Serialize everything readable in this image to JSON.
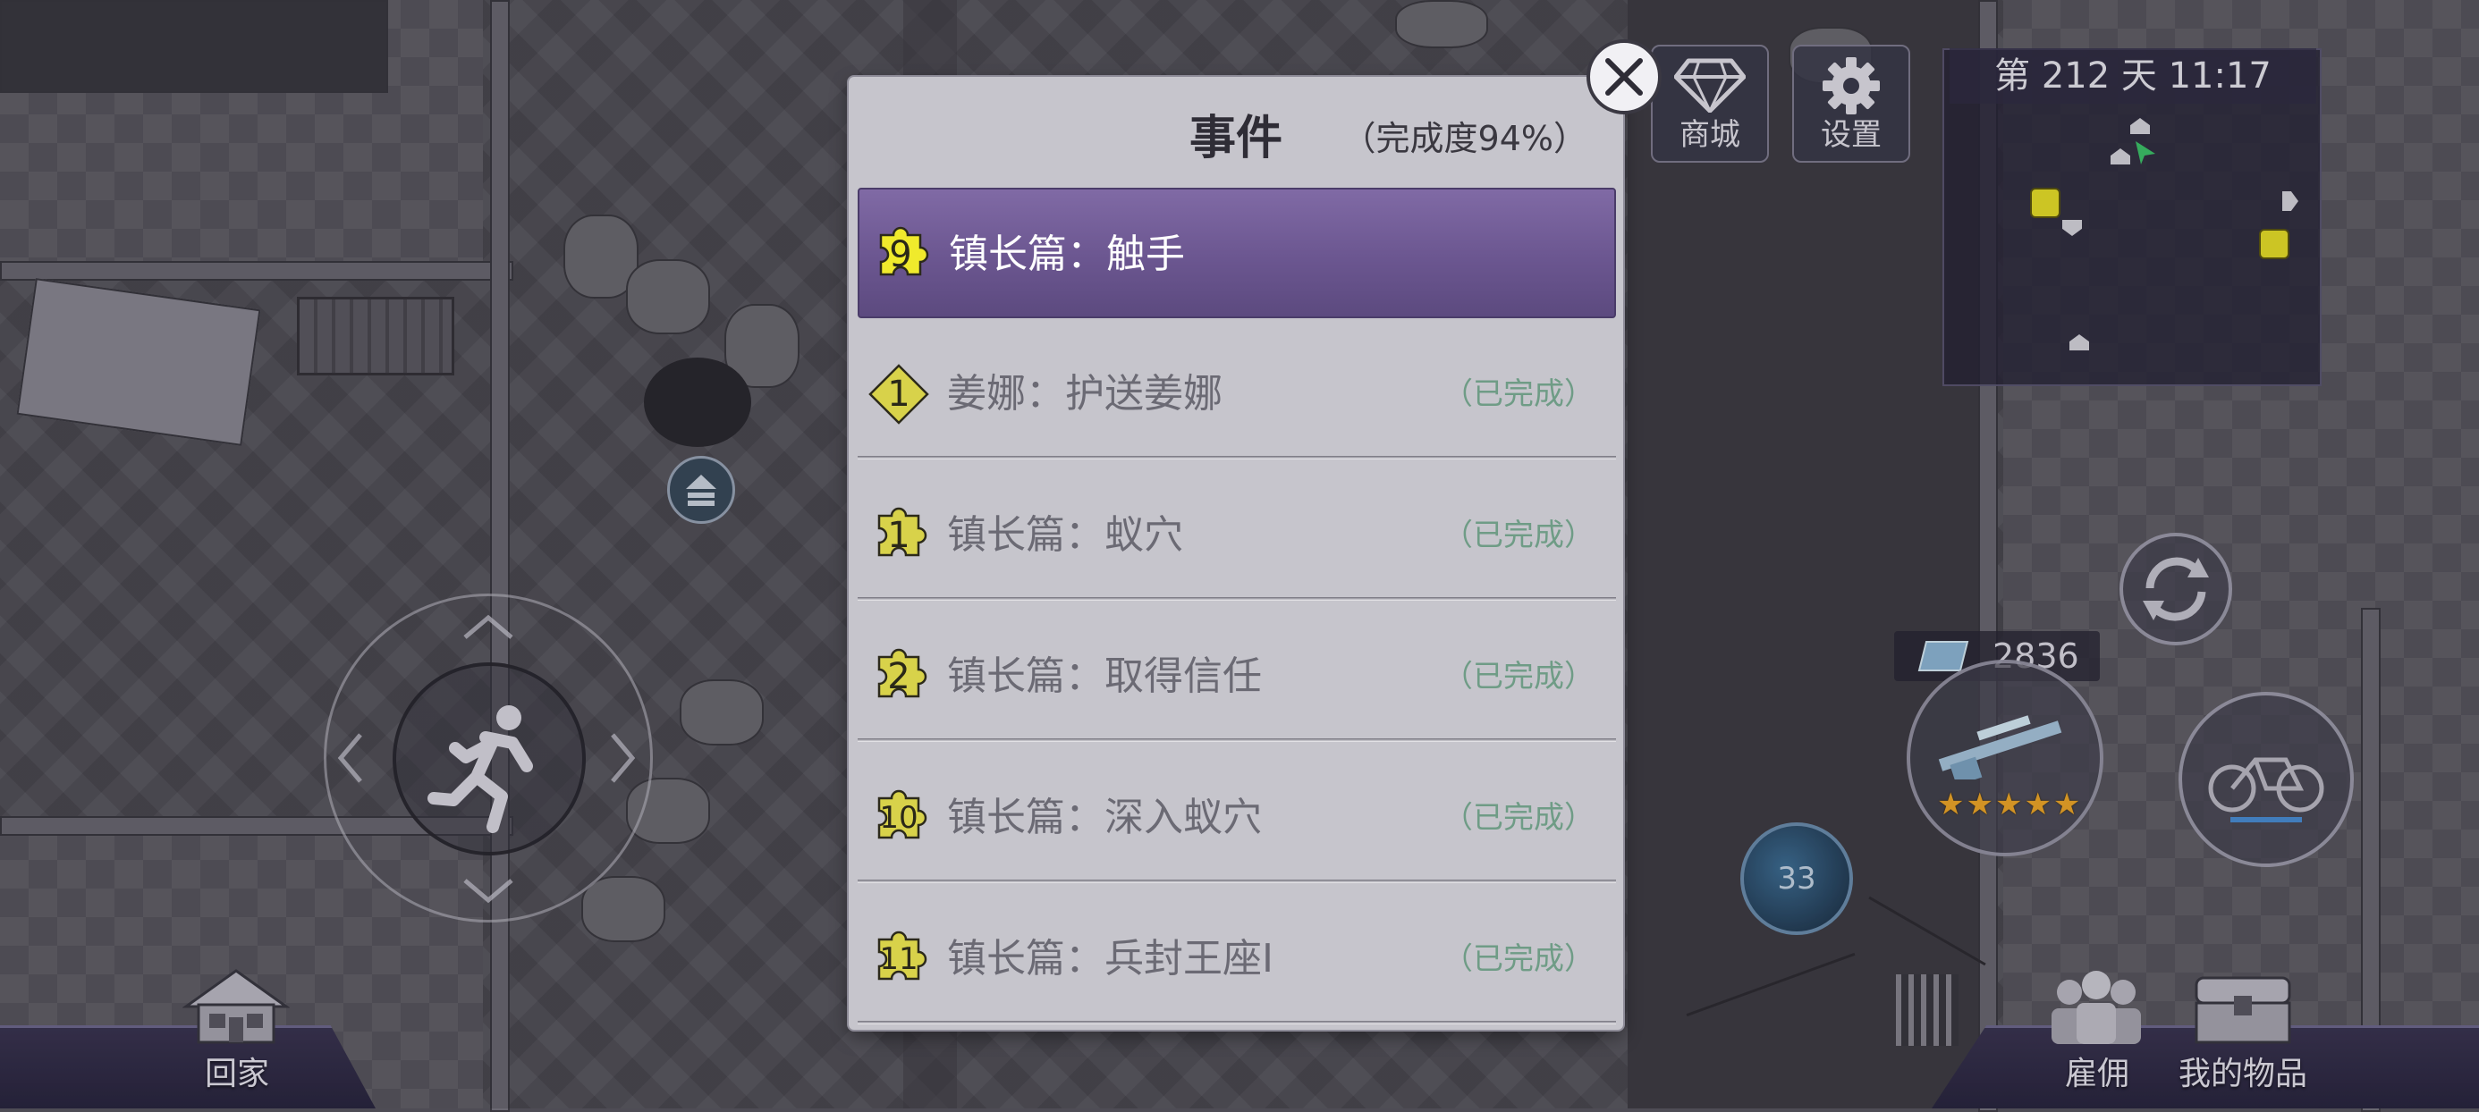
{
  "dialog": {
    "title": "事件",
    "progress": "（完成度94%）",
    "events": [
      {
        "badge_shape": "puzzle-icon",
        "number": "9",
        "title": "镇长篇：触手",
        "status": "",
        "active": true
      },
      {
        "badge_shape": "diamond-icon",
        "number": "1",
        "title": "姜娜：护送姜娜",
        "status": "（已完成）",
        "active": false
      },
      {
        "badge_shape": "puzzle-icon",
        "number": "1",
        "title": "镇长篇：蚁穴",
        "status": "（已完成）",
        "active": false
      },
      {
        "badge_shape": "puzzle-icon",
        "number": "2",
        "title": "镇长篇：取得信任",
        "status": "（已完成）",
        "active": false
      },
      {
        "badge_shape": "puzzle-icon",
        "number": "10",
        "title": "镇长篇：深入蚁穴",
        "status": "（已完成）",
        "active": false
      },
      {
        "badge_shape": "puzzle-icon",
        "number": "11",
        "title": "镇长篇：兵封王座I",
        "status": "（已完成）",
        "active": false
      }
    ]
  },
  "hud": {
    "shop_label": "商城",
    "settings_label": "设置",
    "day_time": "第 212 天  11:17",
    "home_label": "回家",
    "hire_label": "雇佣",
    "items_label": "我的物品",
    "ammo_count": "2836",
    "skill_cooldown": "33",
    "weapon_stars": 5
  },
  "colors": {
    "active_row": "#6b5690",
    "badge_yellow": "#f0ea2c",
    "status_green": "#6f9c86",
    "dialog_bg": "#c6c5cc"
  }
}
